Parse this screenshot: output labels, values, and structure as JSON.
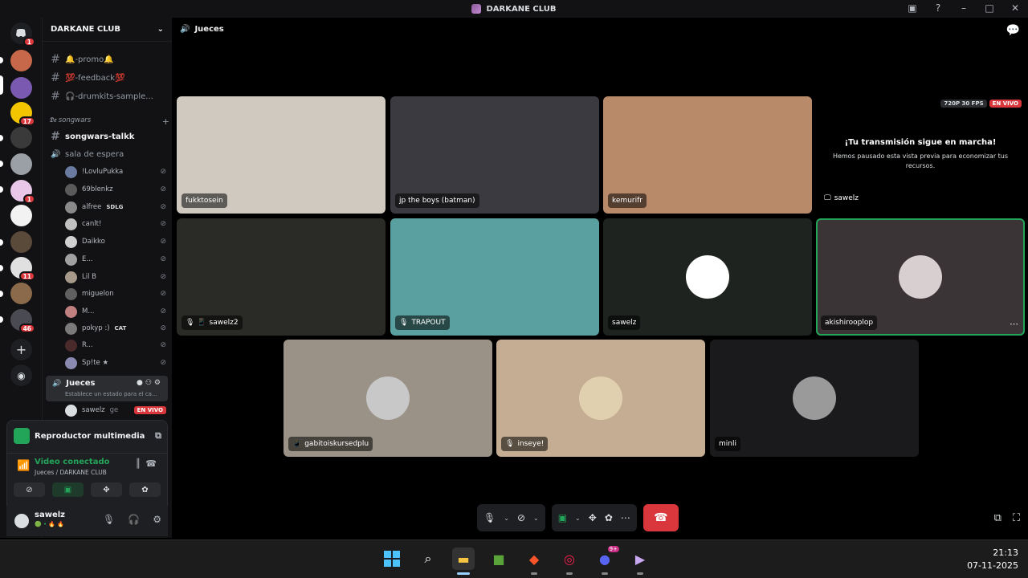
{
  "window": {
    "title": "DARKANE CLUB"
  },
  "rail": {
    "servers": [
      {
        "name": "discord-home",
        "badge": "1",
        "color": "#5865f2"
      },
      {
        "name": "server-1",
        "badge": "",
        "color": "#c7684a"
      },
      {
        "name": "server-2",
        "badge": "",
        "color": "#7a5ab0"
      },
      {
        "name": "server-3",
        "badge": "17",
        "color": "#f2c500"
      },
      {
        "name": "server-4",
        "badge": "",
        "color": "#3a3a3a"
      },
      {
        "name": "server-5",
        "badge": "",
        "color": "#9aa0a6"
      },
      {
        "name": "server-6",
        "badge": "1",
        "color": "#e8c7e8"
      },
      {
        "name": "server-7",
        "badge": "",
        "color": "#f2f2f2"
      },
      {
        "name": "server-8",
        "badge": "",
        "color": "#5a4a3a"
      },
      {
        "name": "server-9",
        "badge": "11",
        "color": "#e0e0e0"
      },
      {
        "name": "server-10",
        "badge": "",
        "color": "#8a6a4a"
      },
      {
        "name": "server-11",
        "badge": "46",
        "color": "#4a4a52"
      }
    ]
  },
  "sidebar": {
    "server_name": "DARKANE CLUB",
    "channels": [
      {
        "label": "🔔-promo🔔",
        "bold": false
      },
      {
        "label": "💯-feedback💯",
        "bold": false
      },
      {
        "label": "🎧-drumkits-sample...",
        "bold": false
      }
    ],
    "category": "𝕯𝖊 songwars",
    "category_channels": [
      {
        "label": "songwars-talkk",
        "bold": true,
        "icon": "#"
      },
      {
        "label": "sala de espera",
        "bold": false,
        "icon": "🔊"
      }
    ],
    "voice_users": [
      {
        "name": "!LovluPukka",
        "tag": "",
        "color": "#6a7aa0"
      },
      {
        "name": "69blenkz",
        "tag": "",
        "color": "#5a5a5a"
      },
      {
        "name": "alfree",
        "tag": "SDLG",
        "color": "#8a8a8a"
      },
      {
        "name": "canlt!",
        "tag": "",
        "color": "#c0c0c0"
      },
      {
        "name": "Daikko",
        "tag": "",
        "color": "#d0d0d0"
      },
      {
        "name": "E...",
        "tag": "",
        "color": "#a0a0a0"
      },
      {
        "name": "Lil B",
        "tag": "",
        "color": "#a89a8a"
      },
      {
        "name": "miguelon",
        "tag": "",
        "color": "#606060"
      },
      {
        "name": "M...",
        "tag": "",
        "color": "#c08080"
      },
      {
        "name": "pokyp :)",
        "tag": "CAT",
        "color": "#7a7a7a"
      },
      {
        "name": "R...",
        "tag": "",
        "color": "#4a2a2a"
      },
      {
        "name": "Sp!te ★",
        "tag": "",
        "color": "#8a8ab0"
      }
    ],
    "current_voice": {
      "name": "Jueces",
      "status": "Establece un estado para el ca..."
    },
    "current_user_line": {
      "name": "sawelz",
      "extra": "ge",
      "live": "EN VIVO"
    }
  },
  "media_panel": {
    "title": "Reproductor multimedia",
    "conn_status": "Video conectado",
    "conn_channel": "Jueces / DARKANE CLUB"
  },
  "user": {
    "name": "sawelz",
    "status": "🟢 • 🔥 🔥"
  },
  "main": {
    "channel": "Jueces",
    "tiles": [
      {
        "name": "fukktosein",
        "icon": "",
        "bg": "#cfc9c0",
        "avatar": ""
      },
      {
        "name": "jp the boys (batman)",
        "icon": "",
        "bg": "#3a3a40",
        "avatar": ""
      },
      {
        "name": "kemurifr",
        "icon": "",
        "bg": "#b88a6a",
        "avatar": ""
      },
      {
        "name": "sawelz2",
        "icon": "🎙 📱",
        "bg": "#2a2a26",
        "avatar": ""
      },
      {
        "name": "TRAPOUT",
        "icon": "🎙",
        "bg": "#5aa0a0",
        "avatar": ""
      },
      {
        "name": "sawelz",
        "icon": "",
        "bg": "#1e2320",
        "avatar": "#ffffff"
      },
      {
        "name": "akishirooplop",
        "icon": "",
        "bg": "#3a3436",
        "avatar": "#d8d0d0"
      },
      {
        "name": "gabitoiskursedplu",
        "icon": "📱",
        "bg": "#9a9286",
        "avatar": "#c8c8c8"
      },
      {
        "name": "inseye!",
        "icon": "🎙",
        "bg": "#c4ad92",
        "avatar": "#e0d0b0"
      },
      {
        "name": "minli",
        "icon": "",
        "bg": "#1a1a1c",
        "avatar": "#9a9a9a"
      }
    ],
    "stream": {
      "quality": "720P 30 FPS",
      "live": "EN VIVO",
      "heading": "¡Tu transmisión sigue en marcha!",
      "body": "Hemos pausado esta vista previa para economizar tus recursos.",
      "owner": "sawelz"
    }
  },
  "taskbar": {
    "time": "21:13",
    "date": "07-11-2025",
    "badge": "9+"
  }
}
